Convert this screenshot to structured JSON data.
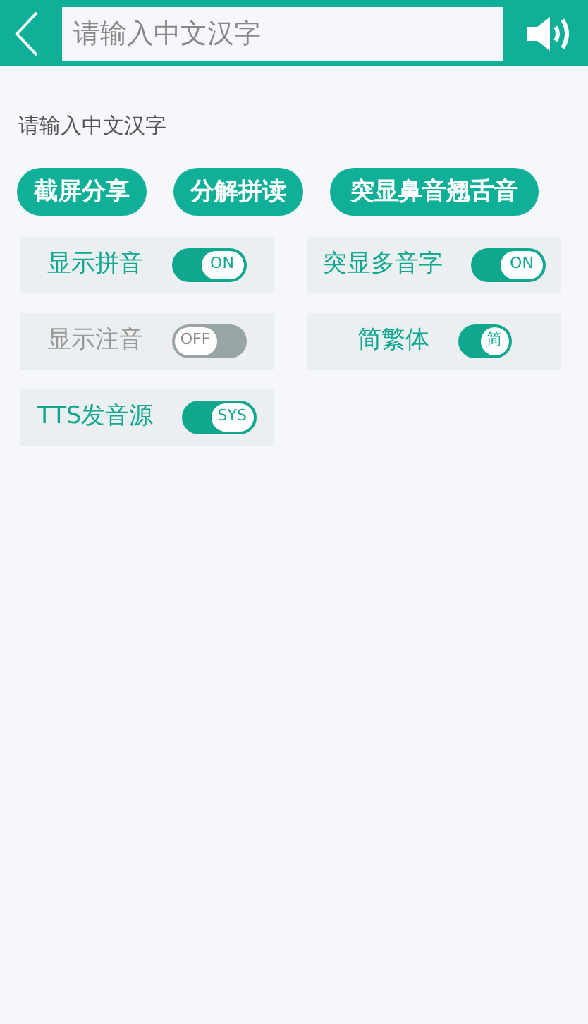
{
  "header": {
    "search": {
      "placeholder": "请输入中文汉字"
    }
  },
  "hint": "请输入中文汉字",
  "buttons": [
    "截屏分享",
    "分解拼读",
    "突显鼻音翘舌音"
  ],
  "toggles": [
    {
      "label": "显示拼音",
      "on": true,
      "switch_text": "ON",
      "kind": "wide"
    },
    {
      "label": "突显多音字",
      "on": true,
      "switch_text": "ON",
      "kind": "wide"
    },
    {
      "label": "显示注音",
      "on": false,
      "switch_text": "OFF",
      "kind": "wide"
    },
    {
      "label": "简繁体",
      "on": true,
      "switch_text": "简",
      "kind": "compact"
    },
    {
      "label": "TTS发音源",
      "on": true,
      "switch_text": "SYS",
      "kind": "wide"
    }
  ]
}
